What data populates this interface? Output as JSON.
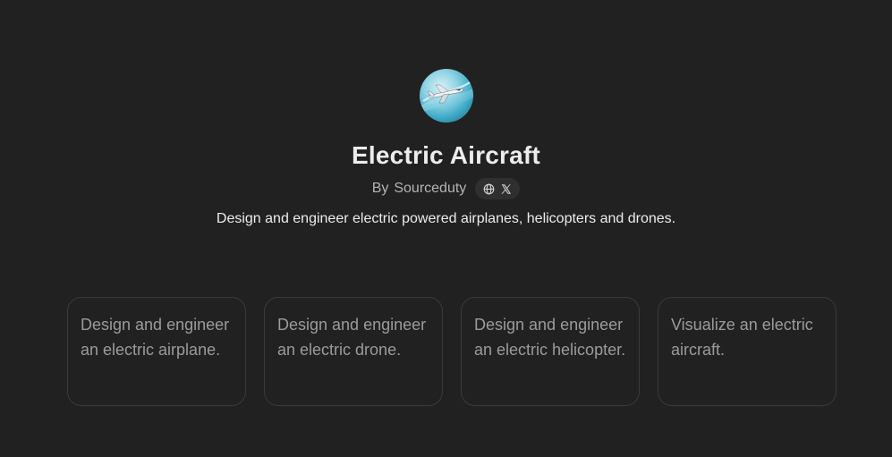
{
  "gpt": {
    "title": "Electric Aircraft",
    "byline_prefix": "By",
    "author": "Sourceduty",
    "description": "Design and engineer electric powered airplanes, helicopters and drones.",
    "links": [
      {
        "icon": "globe-icon"
      },
      {
        "icon": "x-logo-icon"
      }
    ]
  },
  "prompts": [
    {
      "text": "Design and engineer an electric airplane."
    },
    {
      "text": "Design and engineer an electric drone."
    },
    {
      "text": "Design and engineer an electric helicopter."
    },
    {
      "text": "Visualize an electric aircraft."
    }
  ],
  "colors": {
    "background": "#212121",
    "text_primary": "#ececec",
    "text_secondary": "#b4b4b4",
    "card_border": "#3a3a3a",
    "card_text": "#9b9b9b"
  }
}
